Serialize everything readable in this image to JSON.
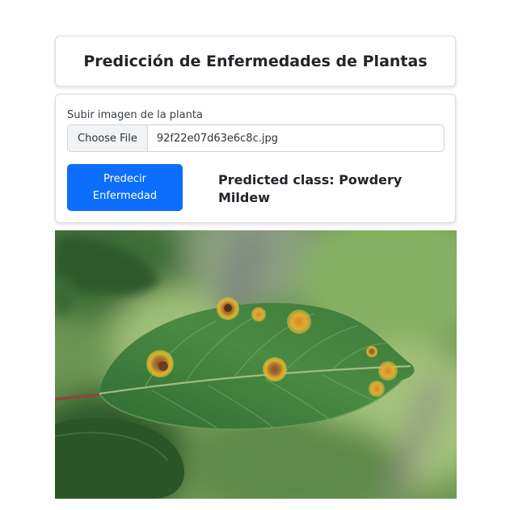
{
  "header": {
    "title": "Predicción de Enfermedades de Plantas"
  },
  "upload": {
    "label": "Subir imagen de la planta",
    "choose_button": "Choose File",
    "file_name": "92f22e07d63e6c8c.jpg"
  },
  "predict_button": {
    "label": "Predecir Enfermedad"
  },
  "result": {
    "text": "Predicted class: Powdery Mildew"
  },
  "colors": {
    "primary": "#0d6efd",
    "leaf": "#3f7a3c",
    "background_blur": "#6f9a55"
  }
}
